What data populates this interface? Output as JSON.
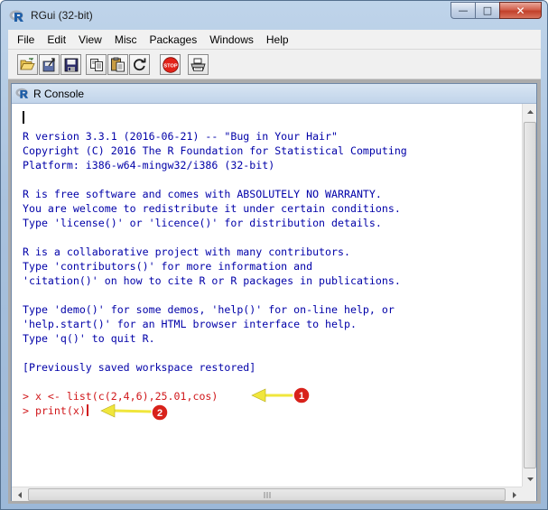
{
  "window": {
    "title": "RGui (32-bit)",
    "controls": {
      "minimize": "—",
      "maximize": "□",
      "close": "✕"
    }
  },
  "menubar": {
    "items": [
      "File",
      "Edit",
      "View",
      "Misc",
      "Packages",
      "Windows",
      "Help"
    ]
  },
  "toolbar": {
    "buttons": [
      {
        "name": "open-script",
        "icon": "folder-open-icon"
      },
      {
        "name": "load-workspace",
        "icon": "load-icon"
      },
      {
        "name": "save-workspace",
        "icon": "floppy-disk-icon"
      },
      {
        "name": "copy",
        "icon": "copy-icon"
      },
      {
        "name": "paste",
        "icon": "paste-icon"
      },
      {
        "name": "copy-paste",
        "icon": "refresh-icon"
      },
      {
        "name": "stop",
        "icon": "stop-icon",
        "label": "STOP"
      },
      {
        "name": "print",
        "icon": "printer-icon"
      }
    ]
  },
  "console": {
    "title": "R Console",
    "lines": [
      "R version 3.3.1 (2016-06-21) -- \"Bug in Your Hair\"",
      "Copyright (C) 2016 The R Foundation for Statistical Computing",
      "Platform: i386-w64-mingw32/i386 (32-bit)",
      "",
      "R is free software and comes with ABSOLUTELY NO WARRANTY.",
      "You are welcome to redistribute it under certain conditions.",
      "Type 'license()' or 'licence()' for distribution details.",
      "",
      "R is a collaborative project with many contributors.",
      "Type 'contributors()' for more information and",
      "'citation()' on how to cite R or R packages in publications.",
      "",
      "Type 'demo()' for some demos, 'help()' for on-line help, or",
      "'help.start()' for an HTML browser interface to help.",
      "Type 'q()' to quit R.",
      "",
      "[Previously saved workspace restored]",
      ""
    ],
    "commands": [
      "> x <- list(c(2,4,6),25.01,cos)",
      "> print(x)"
    ]
  },
  "annotations": [
    {
      "number": "1"
    },
    {
      "number": "2"
    }
  ],
  "colors": {
    "output_text": "#0000a8",
    "command_text": "#d0171a",
    "annotation_arrow": "#f0e63c",
    "annotation_badge": "#d8221b"
  }
}
